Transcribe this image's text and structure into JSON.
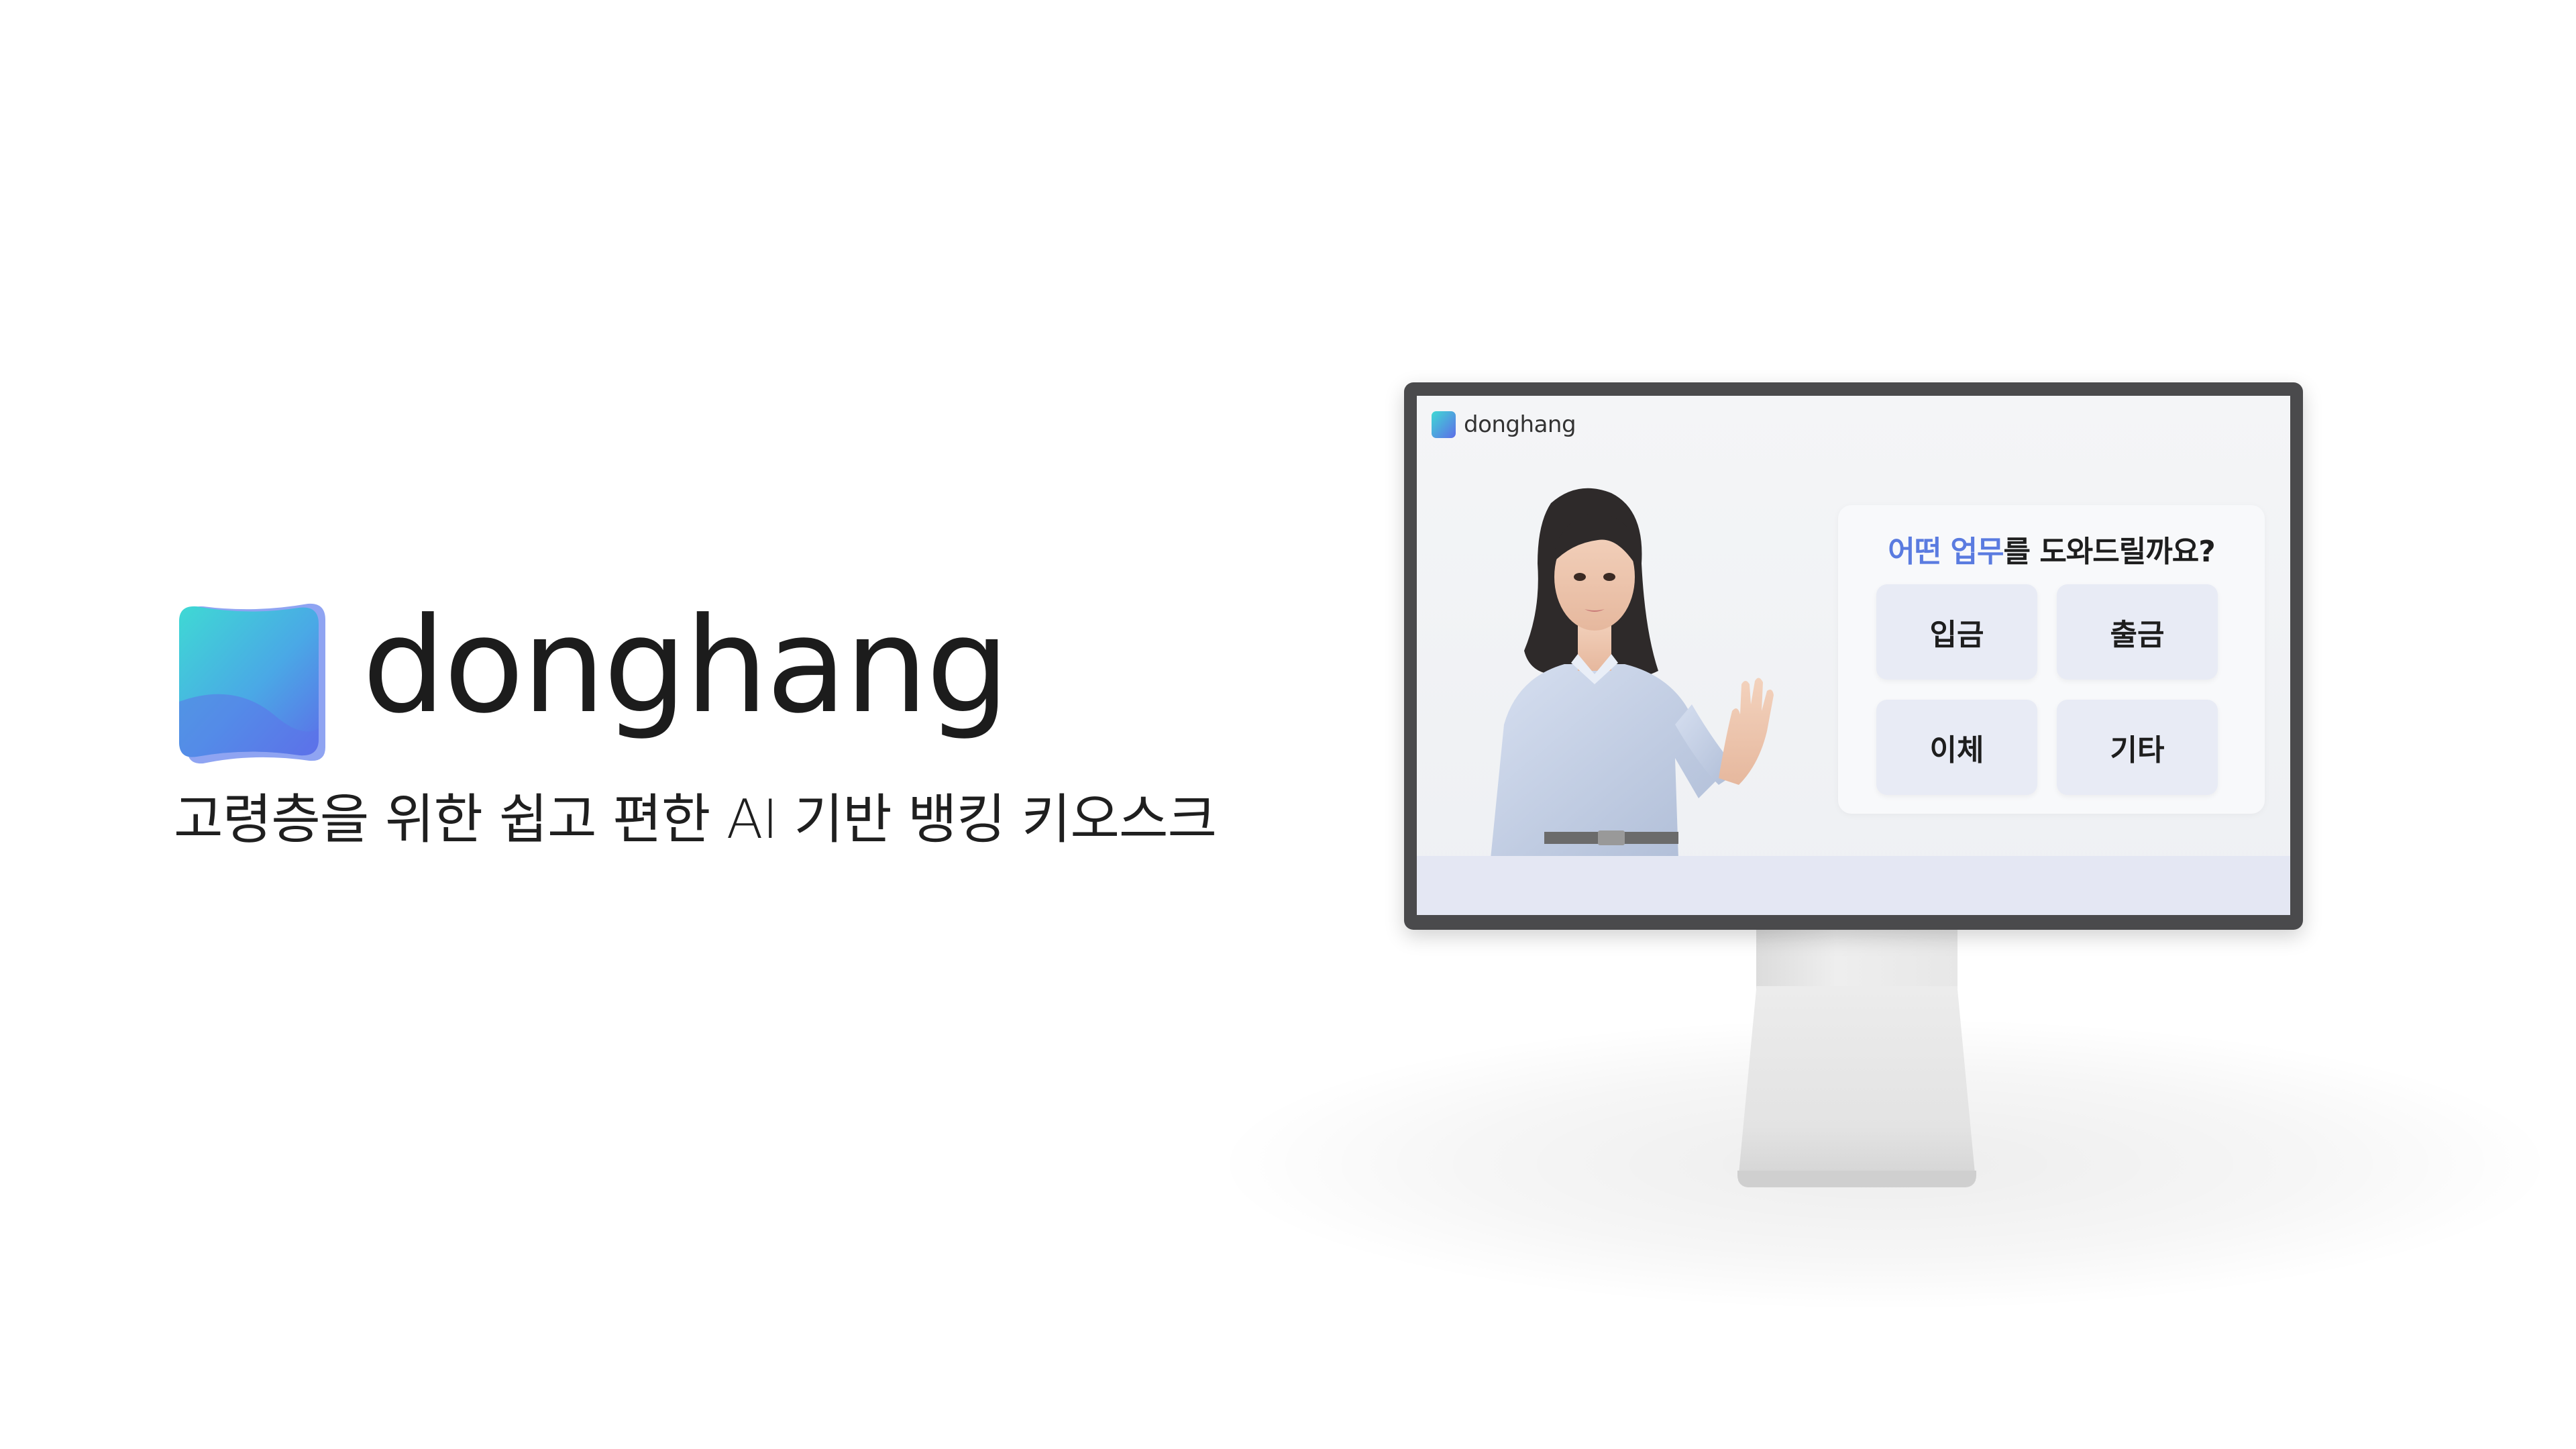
{
  "brand": {
    "name": "donghang",
    "tagline": "고령층을 위한 쉽고 편한 AI 기반 뱅킹 키오스크",
    "logo_colors": [
      "#3ed5d6",
      "#5a6fe8"
    ]
  },
  "kiosk": {
    "screen": {
      "brand": "donghang",
      "question_highlight": "어떤 업무",
      "question_rest": "를 도와드릴까요?",
      "highlight_color": "#5a7be0",
      "options": [
        {
          "label": "입금"
        },
        {
          "label": "출금"
        },
        {
          "label": "이체"
        },
        {
          "label": "기타"
        }
      ]
    }
  }
}
